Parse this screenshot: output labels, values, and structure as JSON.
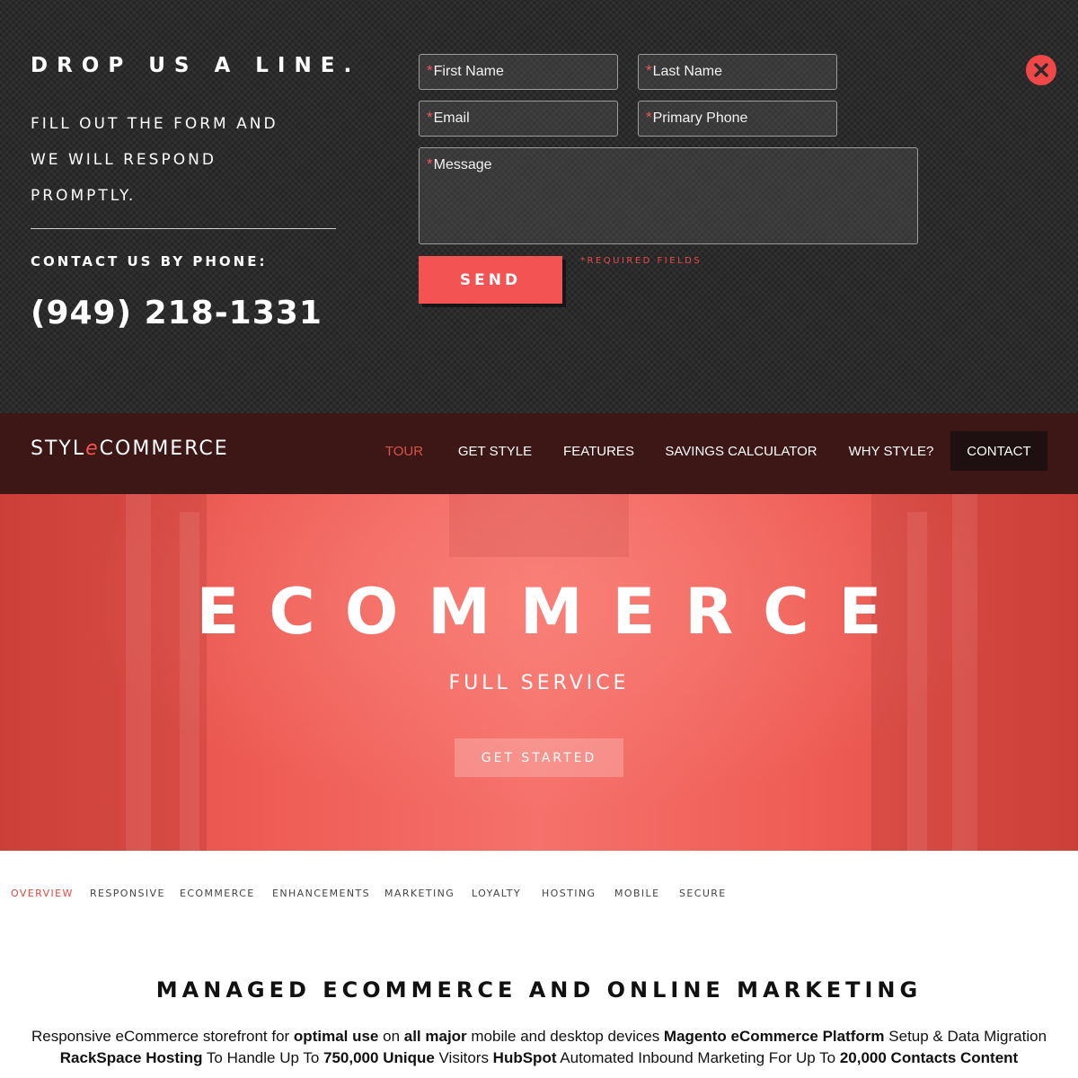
{
  "contact": {
    "heading": "DROP US A LINE.",
    "sub_lines": [
      "FILL OUT THE FORM AND",
      "WE WILL RESPOND",
      "PROMPTLY."
    ],
    "phone_label": "CONTACT US BY PHONE:",
    "phone": "(949) 218-1331",
    "fields": {
      "first_name": "First Name",
      "last_name": "Last Name",
      "email": "Email",
      "primary_phone": "Primary Phone",
      "message": "Message"
    },
    "required_marker": "*",
    "send_label": "SEND",
    "required_note": "*REQUIRED FIELDS"
  },
  "nav": {
    "logo_pre": "STYL",
    "logo_e": "e",
    "logo_post": "COMMERCE",
    "items": [
      "TOUR",
      "GET STYLE",
      "FEATURES",
      "SAVINGS CALCULATOR",
      "WHY STYLE?",
      "CONTACT"
    ],
    "active": "TOUR"
  },
  "hero": {
    "title": "ECOMMERCE",
    "subtitle": "FULL SERVICE",
    "cta": "GET STARTED"
  },
  "tabs": [
    "OVERVIEW",
    "RESPONSIVE",
    "ECOMMERCE",
    "ENHANCEMENTS",
    "MARKETING",
    "LOYALTY",
    "HOSTING",
    "MOBILE",
    "SECURE"
  ],
  "content": {
    "title": "MANAGED ECOMMERCE AND ONLINE MARKETING",
    "body": [
      {
        "t": "Responsive eCommerce storefront for ",
        "b": false
      },
      {
        "t": "optimal use",
        "b": true
      },
      {
        "t": " on ",
        "b": false
      },
      {
        "t": "all major",
        "b": true
      },
      {
        "t": " mobile and desktop devices ",
        "b": false
      },
      {
        "t": "Magento eCommerce Platform",
        "b": true
      },
      {
        "t": " Setup & Data Migration ",
        "b": false
      },
      {
        "t": "RackSpace Hosting",
        "b": true
      },
      {
        "t": " To Handle Up To ",
        "b": false
      },
      {
        "t": "750,000 Unique",
        "b": true
      },
      {
        "t": " Visitors ",
        "b": false
      },
      {
        "t": "HubSpot",
        "b": true
      },
      {
        "t": " Automated Inbound Marketing For Up To ",
        "b": false
      },
      {
        "t": "20,000 Contacts Content",
        "b": true
      },
      {
        "t": " ",
        "b": false
      }
    ]
  },
  "colors": {
    "accent": "#f45353",
    "panel_bg": "#2b2b2b",
    "nav_bg": "#3d1716"
  }
}
